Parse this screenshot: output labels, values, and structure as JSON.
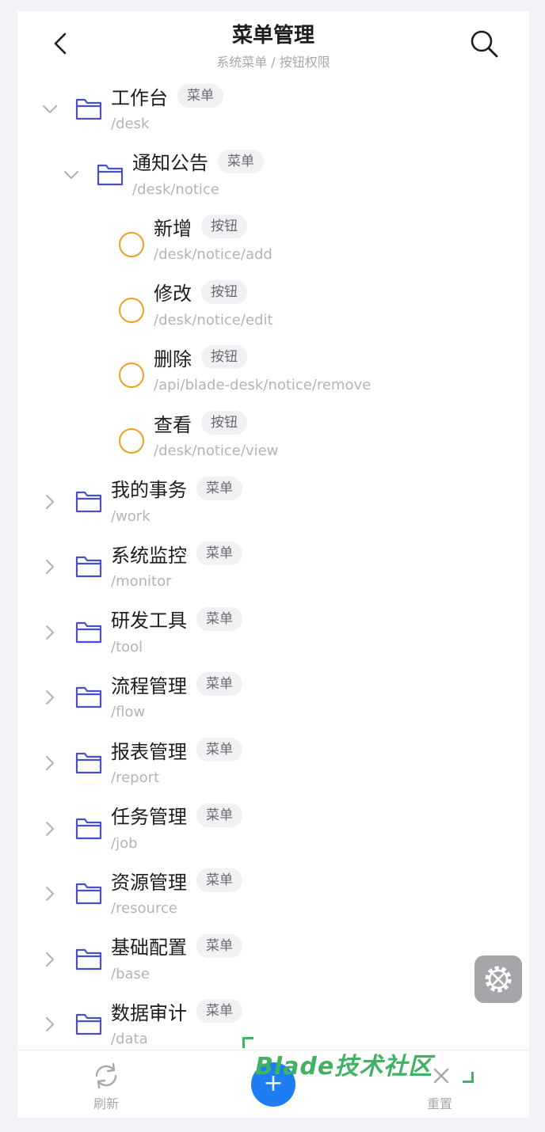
{
  "header": {
    "title": "菜单管理",
    "subtitle": "系统菜单 / 按钮权限"
  },
  "tree": [
    {
      "name": "工作台",
      "tag": "菜单",
      "path": "/desk",
      "level": 0,
      "kind": "folder",
      "expanded": true
    },
    {
      "name": "通知公告",
      "tag": "菜单",
      "path": "/desk/notice",
      "level": 1,
      "kind": "folder",
      "expanded": true
    },
    {
      "name": "新增",
      "tag": "按钮",
      "path": "/desk/notice/add",
      "level": 2,
      "kind": "button"
    },
    {
      "name": "修改",
      "tag": "按钮",
      "path": "/desk/notice/edit",
      "level": 2,
      "kind": "button"
    },
    {
      "name": "删除",
      "tag": "按钮",
      "path": "/api/blade-desk/notice/remove",
      "level": 2,
      "kind": "button"
    },
    {
      "name": "查看",
      "tag": "按钮",
      "path": "/desk/notice/view",
      "level": 2,
      "kind": "button"
    },
    {
      "name": "我的事务",
      "tag": "菜单",
      "path": "/work",
      "level": 0,
      "kind": "folder",
      "expanded": false
    },
    {
      "name": "系统监控",
      "tag": "菜单",
      "path": "/monitor",
      "level": 0,
      "kind": "folder",
      "expanded": false
    },
    {
      "name": "研发工具",
      "tag": "菜单",
      "path": "/tool",
      "level": 0,
      "kind": "folder",
      "expanded": false
    },
    {
      "name": "流程管理",
      "tag": "菜单",
      "path": "/flow",
      "level": 0,
      "kind": "folder",
      "expanded": false
    },
    {
      "name": "报表管理",
      "tag": "菜单",
      "path": "/report",
      "level": 0,
      "kind": "folder",
      "expanded": false
    },
    {
      "name": "任务管理",
      "tag": "菜单",
      "path": "/job",
      "level": 0,
      "kind": "folder",
      "expanded": false
    },
    {
      "name": "资源管理",
      "tag": "菜单",
      "path": "/resource",
      "level": 0,
      "kind": "folder",
      "expanded": false
    },
    {
      "name": "基础配置",
      "tag": "菜单",
      "path": "/base",
      "level": 0,
      "kind": "folder",
      "expanded": false
    },
    {
      "name": "数据审计",
      "tag": "菜单",
      "path": "/data",
      "level": 0,
      "kind": "folder",
      "expanded": false
    }
  ],
  "bottom_bar": {
    "refresh_label": "刷新",
    "reset_label": "重置",
    "add_label": "+"
  },
  "watermark": {
    "text": "Blade技术社区"
  },
  "colors": {
    "folder": "#4a4fc6",
    "button_ring": "#f0a020",
    "primary": "#1e7cf5",
    "watermark": "#3fb264"
  }
}
